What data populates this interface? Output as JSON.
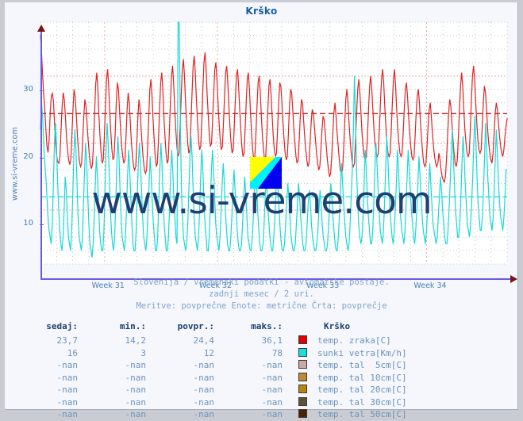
{
  "title": "Krško",
  "watermark": "www.si-vreme.com",
  "side_watermark": "www.si-vreme.com",
  "caption": {
    "line1": "Slovenija / vremenski podatki - avtomatske postaje.",
    "line2": "zadnji mesec / 2 uri.",
    "line3": "Meritve: povprečne  Enote: metrične  Črta: povprečje"
  },
  "table": {
    "headers": [
      "sedaj:",
      "min.:",
      "povpr.:",
      "maks.:",
      "Krško"
    ],
    "rows": [
      {
        "sedaj": "23,7",
        "min": "14,2",
        "povpr": "24,4",
        "maks": "36,1",
        "color": "#e00000",
        "label": "temp. zraka[C]"
      },
      {
        "sedaj": "16",
        "min": "3",
        "povpr": "12",
        "maks": "78",
        "color": "#16e0e0",
        "label": "sunki vetra[Km/h]"
      },
      {
        "sedaj": "-nan",
        "min": "-nan",
        "povpr": "-nan",
        "maks": "-nan",
        "color": "#c9a8a8",
        "label": "temp. tal  5cm[C]"
      },
      {
        "sedaj": "-nan",
        "min": "-nan",
        "povpr": "-nan",
        "maks": "-nan",
        "color": "#c08a33",
        "label": "temp. tal 10cm[C]"
      },
      {
        "sedaj": "-nan",
        "min": "-nan",
        "povpr": "-nan",
        "maks": "-nan",
        "color": "#b8860b",
        "label": "temp. tal 20cm[C]"
      },
      {
        "sedaj": "-nan",
        "min": "-nan",
        "povpr": "-nan",
        "maks": "-nan",
        "color": "#5a5238",
        "label": "temp. tal 30cm[C]"
      },
      {
        "sedaj": "-nan",
        "min": "-nan",
        "povpr": "-nan",
        "maks": "-nan",
        "color": "#4a2400",
        "label": "temp. tal 50cm[C]"
      }
    ]
  },
  "chart_data": {
    "type": "line",
    "title": "Krško",
    "xlabel": "",
    "ylabel": "",
    "ylim": [
      2,
      38
    ],
    "yticks": [
      10,
      20,
      30
    ],
    "grid": true,
    "legend_position": "below-table",
    "x_tick_labels": [
      "Week 31",
      "Week 32",
      "Week 33",
      "Week 34"
    ],
    "x_tick_positions": [
      0.145,
      0.375,
      0.605,
      0.835
    ],
    "averages": [
      {
        "name": "temp. zraka[C]",
        "value": 24.4,
        "color": "#b00000",
        "style": "dashed"
      },
      {
        "name": "sunki vetra[Km/h]",
        "value": 12,
        "color": "#16d8d8",
        "style": "dashed"
      }
    ],
    "series": [
      {
        "name": "temp. zraka[C]",
        "unit": "C",
        "color": "#e02222",
        "min": 14.2,
        "avg": 24.4,
        "max": 36.1,
        "current": 23.7,
        "values": [
          36.1,
          33.5,
          30.0,
          27.2,
          25.0,
          22.0,
          19.5,
          18.6,
          20.5,
          24.5,
          27.0,
          27.4,
          26.2,
          23.0,
          20.0,
          18.0,
          17.2,
          17.0,
          18.0,
          22.0,
          25.5,
          27.5,
          26.5,
          24.0,
          21.0,
          19.0,
          17.5,
          16.8,
          17.5,
          21.0,
          25.0,
          28.0,
          27.0,
          24.5,
          21.5,
          19.0,
          17.2,
          16.5,
          17.0,
          20.5,
          24.0,
          26.5,
          25.5,
          23.0,
          20.5,
          18.5,
          17.0,
          16.2,
          16.8,
          20.0,
          24.5,
          28.8,
          30.5,
          28.0,
          24.0,
          21.0,
          18.5,
          17.0,
          17.5,
          21.0,
          25.5,
          29.5,
          31.0,
          28.5,
          24.5,
          21.5,
          19.0,
          17.5,
          18.0,
          21.5,
          26.0,
          29.0,
          28.0,
          25.0,
          22.0,
          19.5,
          18.0,
          17.0,
          17.5,
          21.0,
          25.0,
          27.5,
          26.0,
          23.0,
          20.0,
          18.0,
          16.5,
          16.0,
          16.5,
          20.0,
          24.0,
          26.5,
          25.0,
          22.0,
          19.5,
          17.5,
          16.0,
          15.5,
          16.0,
          19.5,
          24.0,
          28.0,
          29.5,
          27.0,
          23.5,
          20.5,
          18.0,
          16.5,
          17.0,
          20.5,
          25.0,
          29.0,
          30.5,
          28.0,
          24.0,
          21.0,
          18.5,
          17.0,
          17.5,
          21.5,
          26.0,
          30.0,
          31.5,
          29.0,
          25.0,
          22.0,
          19.5,
          18.0,
          18.5,
          22.5,
          27.0,
          31.0,
          32.5,
          30.0,
          26.0,
          23.0,
          20.0,
          18.5,
          19.0,
          23.0,
          27.5,
          31.5,
          33.0,
          30.5,
          26.5,
          23.5,
          20.5,
          19.0,
          19.5,
          23.5,
          28.0,
          32.0,
          33.5,
          31.0,
          27.0,
          24.0,
          21.0,
          19.5,
          20.0,
          23.5,
          27.5,
          31.0,
          32.0,
          29.5,
          26.0,
          23.0,
          20.5,
          19.0,
          19.5,
          23.0,
          27.0,
          30.5,
          31.5,
          29.0,
          25.5,
          22.5,
          20.0,
          18.5,
          19.0,
          22.5,
          26.5,
          30.0,
          31.0,
          28.5,
          25.0,
          22.0,
          19.5,
          18.0,
          18.5,
          22.0,
          26.0,
          29.5,
          30.5,
          28.0,
          24.5,
          21.5,
          19.0,
          17.5,
          18.0,
          21.5,
          25.5,
          29.0,
          30.0,
          27.5,
          24.0,
          21.0,
          19.0,
          17.5,
          18.0,
          21.0,
          25.0,
          28.5,
          29.5,
          27.0,
          24.0,
          21.0,
          19.0,
          18.0,
          18.5,
          22.0,
          26.0,
          29.0,
          28.5,
          26.0,
          23.0,
          20.5,
          18.5,
          17.5,
          18.0,
          21.5,
          25.5,
          28.0,
          27.5,
          25.0,
          22.0,
          20.0,
          18.0,
          17.0,
          17.5,
          20.5,
          24.0,
          26.5,
          26.0,
          23.5,
          21.0,
          19.0,
          17.5,
          16.5,
          17.0,
          20.0,
          23.0,
          25.0,
          24.5,
          22.5,
          20.5,
          18.5,
          17.0,
          16.0,
          16.5,
          19.0,
          22.0,
          24.0,
          23.5,
          21.5,
          19.5,
          17.5,
          16.0,
          15.0,
          15.5,
          18.0,
          21.5,
          24.5,
          26.0,
          24.0,
          21.5,
          19.5,
          17.5,
          16.0,
          15.5,
          16.0,
          19.0,
          23.0,
          26.5,
          28.0,
          26.0,
          23.0,
          20.5,
          18.5,
          17.0,
          16.5,
          17.0,
          20.5,
          24.5,
          28.0,
          29.5,
          27.5,
          24.5,
          21.5,
          19.5,
          18.0,
          17.5,
          18.0,
          21.0,
          25.0,
          28.5,
          30.0,
          28.0,
          25.0,
          22.0,
          20.0,
          18.5,
          18.0,
          18.5,
          22.0,
          26.0,
          29.5,
          31.0,
          29.0,
          25.5,
          22.5,
          20.0,
          18.5,
          18.0,
          18.5,
          22.0,
          26.0,
          29.5,
          31.0,
          28.5,
          25.0,
          22.0,
          20.0,
          18.5,
          18.0,
          18.5,
          21.5,
          25.0,
          28.0,
          29.0,
          27.0,
          24.0,
          21.5,
          19.5,
          18.0,
          17.5,
          18.0,
          21.0,
          24.5,
          27.0,
          28.0,
          26.0,
          23.0,
          20.5,
          18.5,
          17.0,
          16.5,
          17.0,
          19.5,
          22.5,
          25.0,
          26.0,
          24.0,
          21.5,
          19.5,
          18.0,
          17.0,
          16.5,
          17.0,
          18.5,
          17.5,
          16.0,
          15.0,
          14.5,
          14.2,
          15.0,
          17.5,
          21.0,
          24.5,
          26.5,
          25.5,
          23.0,
          20.5,
          18.5,
          17.0,
          16.5,
          17.5,
          21.0,
          25.0,
          28.5,
          30.5,
          28.5,
          25.0,
          22.0,
          20.0,
          18.5,
          18.0,
          18.5,
          22.0,
          26.5,
          30.0,
          31.5,
          29.5,
          26.0,
          23.0,
          20.5,
          19.0,
          18.5,
          19.0,
          22.5,
          26.0,
          28.5,
          27.5,
          25.0,
          22.0,
          20.0,
          18.5,
          17.5,
          17.0,
          18.5,
          21.5,
          24.5,
          26.0,
          25.0,
          23.0,
          21.0,
          19.5,
          18.5,
          18.0,
          19.0,
          21.0,
          22.5,
          23.7
        ]
      },
      {
        "name": "sunki vetra[Km/h]",
        "unit": "Km/h",
        "color": "#16d8d8",
        "min": 3,
        "avg": 12,
        "max": 78,
        "current": 16,
        "values": [
          22,
          26,
          24,
          20,
          17,
          15,
          12,
          9,
          7,
          6,
          5,
          8,
          14,
          20,
          23,
          19,
          14,
          10,
          7,
          5,
          4,
          6,
          10,
          15,
          13,
          9,
          6,
          5,
          4,
          7,
          12,
          18,
          22,
          19,
          14,
          9,
          6,
          5,
          4,
          6,
          11,
          16,
          20,
          17,
          12,
          8,
          5,
          4,
          3,
          5,
          9,
          14,
          18,
          15,
          11,
          7,
          5,
          4,
          4,
          7,
          13,
          19,
          23,
          20,
          15,
          10,
          7,
          5,
          4,
          6,
          11,
          17,
          21,
          18,
          13,
          9,
          6,
          5,
          4,
          6,
          10,
          15,
          19,
          16,
          12,
          8,
          5,
          4,
          4,
          7,
          12,
          17,
          20,
          17,
          13,
          9,
          6,
          5,
          4,
          6,
          10,
          14,
          18,
          15,
          11,
          8,
          6,
          4,
          4,
          6,
          11,
          16,
          20,
          17,
          12,
          8,
          6,
          4,
          4,
          6,
          10,
          15,
          19,
          16,
          12,
          9,
          6,
          5,
          78,
          50,
          25,
          14,
          9,
          6,
          5,
          4,
          5,
          8,
          13,
          18,
          21,
          18,
          13,
          9,
          6,
          5,
          4,
          6,
          10,
          15,
          19,
          16,
          12,
          8,
          6,
          4,
          4,
          6,
          11,
          16,
          19,
          16,
          12,
          8,
          6,
          5,
          4,
          6,
          10,
          14,
          17,
          14,
          10,
          7,
          5,
          4,
          4,
          6,
          9,
          13,
          16,
          13,
          10,
          7,
          5,
          4,
          4,
          5,
          8,
          12,
          15,
          12,
          9,
          6,
          5,
          4,
          4,
          6,
          9,
          13,
          16,
          14,
          10,
          7,
          5,
          4,
          4,
          5,
          8,
          12,
          15,
          12,
          9,
          7,
          5,
          4,
          4,
          6,
          9,
          13,
          15,
          13,
          10,
          7,
          5,
          4,
          4,
          5,
          8,
          11,
          14,
          12,
          9,
          6,
          5,
          4,
          4,
          5,
          8,
          11,
          14,
          12,
          9,
          7,
          5,
          4,
          4,
          5,
          8,
          11,
          13,
          11,
          8,
          6,
          5,
          4,
          4,
          5,
          7,
          10,
          13,
          11,
          8,
          6,
          5,
          4,
          4,
          5,
          8,
          11,
          14,
          12,
          9,
          7,
          5,
          4,
          4,
          6,
          9,
          13,
          17,
          14,
          11,
          8,
          6,
          5,
          4,
          5,
          8,
          12,
          16,
          22,
          30,
          24,
          16,
          11,
          8,
          6,
          5,
          6,
          9,
          14,
          19,
          16,
          12,
          9,
          7,
          5,
          5,
          7,
          11,
          16,
          20,
          17,
          13,
          10,
          7,
          6,
          5,
          7,
          11,
          16,
          21,
          18,
          14,
          10,
          8,
          6,
          5,
          7,
          10,
          14,
          19,
          16,
          12,
          9,
          7,
          6,
          5,
          7,
          11,
          15,
          19,
          16,
          13,
          10,
          8,
          6,
          5,
          7,
          10,
          14,
          18,
          15,
          12,
          9,
          7,
          6,
          5,
          7,
          10,
          13,
          17,
          14,
          11,
          8,
          7,
          6,
          5,
          6,
          9,
          12,
          15,
          13,
          10,
          8,
          6,
          5,
          5,
          7,
          10,
          14,
          18,
          22,
          18,
          14,
          10,
          8,
          6,
          6,
          8,
          12,
          17,
          21,
          18,
          14,
          11,
          8,
          7,
          6,
          8,
          11,
          15,
          20,
          24,
          20,
          15,
          11,
          9,
          7,
          7,
          9,
          13,
          18,
          23,
          19,
          15,
          12,
          9,
          8,
          7,
          9,
          13,
          18,
          22,
          18,
          14,
          11,
          9,
          8,
          7,
          9,
          12,
          16,
          16
        ]
      }
    ]
  }
}
